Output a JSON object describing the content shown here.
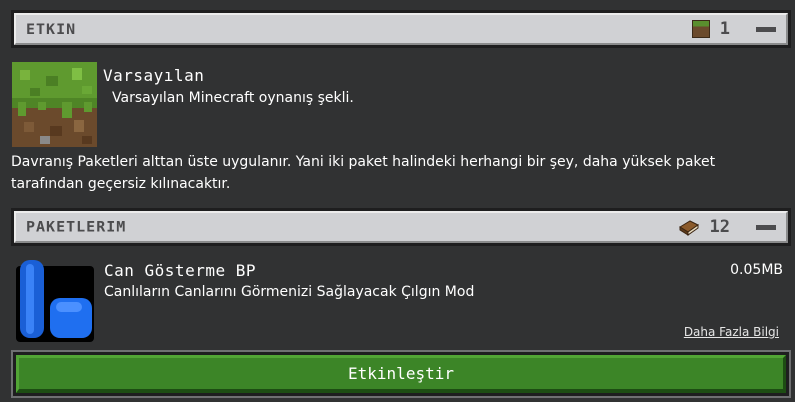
{
  "active_section": {
    "title": "ETKIN",
    "count": "1",
    "icon": "grass-block-icon"
  },
  "default_pack": {
    "name": "Varsayılan",
    "description": "Varsayılan Minecraft oynanış şekli."
  },
  "note": "Davranış Paketleri alttan üste uygulanır. Yani iki paket halindeki herhangi bir şey, daha yüksek paket tarafından geçersiz kılınacaktır.",
  "my_packs_section": {
    "title": "PAKETLERIM",
    "count": "12",
    "icon": "book-icon"
  },
  "my_pack": {
    "name": "Can Gösterme BP",
    "description": "Canlıların Canlarını Görmenizi Sağlayacak Çılgın Mod",
    "size": "0.05MB",
    "more_info": "Daha Fazla Bilgi"
  },
  "activate_button": "Etkinleştir",
  "colors": {
    "background": "#313233",
    "header_bar": "#d0d1d4",
    "header_text": "#4c4c4e",
    "button_green": "#3c8527",
    "icon_blue": "#1f6ff0"
  }
}
